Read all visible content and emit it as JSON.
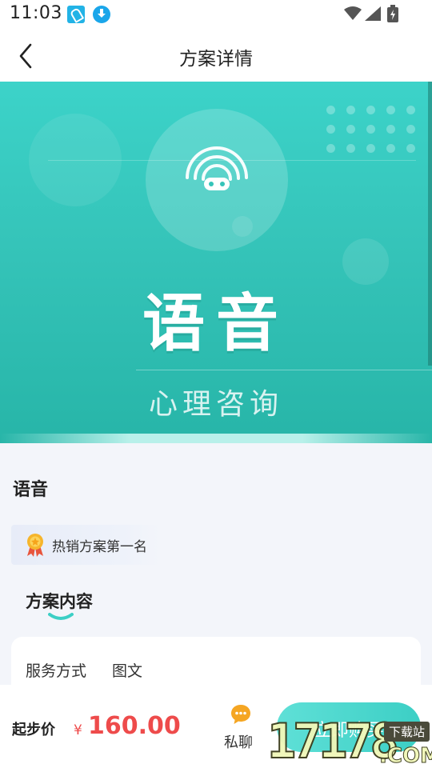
{
  "status_bar": {
    "time": "11:03",
    "icons": [
      "notification-app-icon",
      "download-icon",
      "wifi-icon",
      "signal-icon",
      "battery-icon"
    ]
  },
  "nav": {
    "title": "方案详情",
    "back_icon": "chevron-left-icon"
  },
  "banner": {
    "title": "语音",
    "subtitle": "心理咨询",
    "icon": "voice-chat-icon",
    "colors": {
      "top": "#3cd3c9",
      "bottom": "#27b5a8"
    }
  },
  "plan": {
    "name": "语音",
    "badge_icon": "medal-icon",
    "badge_text": "热销方案第一名"
  },
  "section": {
    "title": "方案内容"
  },
  "service": {
    "label": "服务方式",
    "value": "图文"
  },
  "bottom_bar": {
    "price_label": "起步价",
    "currency_symbol": "¥",
    "price": "160.00",
    "chat_label": "私聊",
    "chat_icon": "chat-bubble-icon",
    "buy_label": "立即购买",
    "price_color": "#ee4b4b",
    "accent_color": "#3ccfc5"
  },
  "watermark": {
    "number": "17178",
    "suffix": ".COM",
    "tag": "下载站"
  }
}
